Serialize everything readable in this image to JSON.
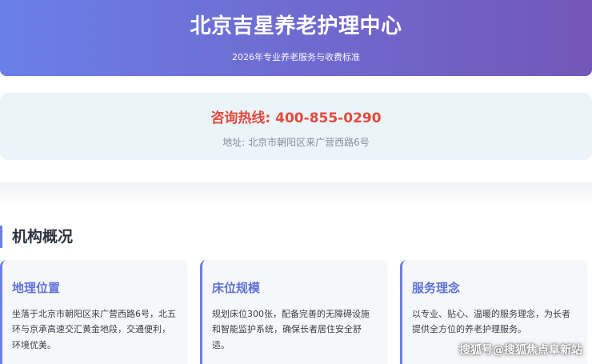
{
  "header": {
    "title": "北京吉星养老护理中心",
    "subtitle": "2026年专业养老服务与收费标准",
    "gradient_start": "#6a7fe8",
    "gradient_end": "#7357b8"
  },
  "contact": {
    "hotline": "咨询热线: 400-855-0290",
    "address": "地址: 北京市朝阳区来广营西路6号",
    "hotline_color": "#e34a3c"
  },
  "overview": {
    "title": "机构概况",
    "cards": [
      {
        "title": "地理位置",
        "text": "坐落于北京市朝阳区来广营西路6号，北五环与京承高速交汇黄金地段，交通便利，环境优美。"
      },
      {
        "title": "床位规模",
        "text": "规划床位300张，配备完善的无障碍设施和智能监护系统，确保长者居住安全舒适。"
      },
      {
        "title": "服务理念",
        "text": "以专业、贴心、温暖的服务理念，为长者提供全方位的养老护理服务。"
      }
    ]
  },
  "watermark": "搜狐号@搜狐焦点阜新站"
}
